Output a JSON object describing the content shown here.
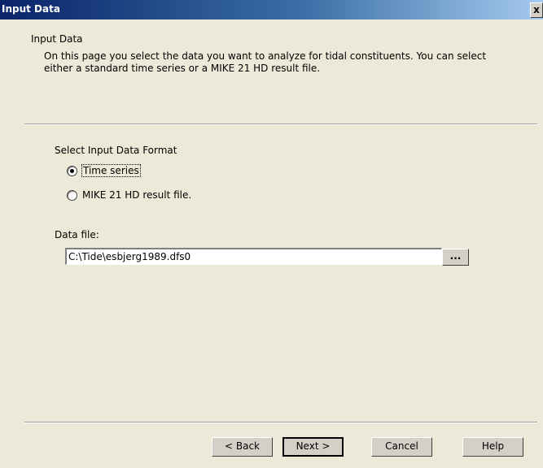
{
  "window": {
    "title": "Input Data",
    "close_glyph": "x"
  },
  "header": {
    "title": "Input Data",
    "description": "On this page you select the data you want to analyze for tidal constituents. You can select either a standard time series or a MIKE 21 HD result file."
  },
  "format": {
    "label": "Select Input Data Format",
    "options": [
      {
        "label": "Time series",
        "selected": true
      },
      {
        "label": "MIKE 21 HD result file.",
        "selected": false
      }
    ]
  },
  "data_file": {
    "label": "Data file:",
    "value": "C:\\Tide\\esbjerg1989.dfs0",
    "browse_label": "..."
  },
  "buttons": {
    "back": "< Back",
    "next": "Next >",
    "cancel": "Cancel",
    "help": "Help"
  }
}
